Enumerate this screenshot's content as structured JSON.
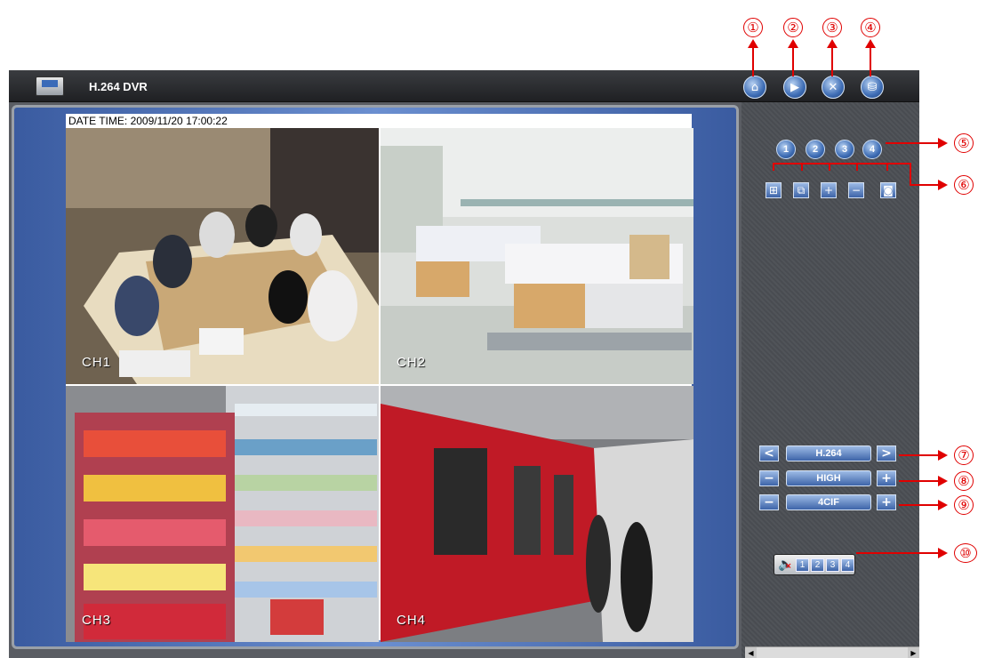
{
  "app": {
    "title": "H.264 DVR"
  },
  "viewer": {
    "datetime": "DATE TIME: 2009/11/20 17:00:22",
    "channels": [
      {
        "label": "CH1"
      },
      {
        "label": "CH2"
      },
      {
        "label": "CH3"
      },
      {
        "label": "CH4"
      }
    ]
  },
  "toolbar": {
    "buttons": [
      {
        "icon": "home-icon",
        "glyph": "⌂"
      },
      {
        "icon": "playback-icon",
        "glyph": "▶"
      },
      {
        "icon": "tools-icon",
        "glyph": "✕"
      },
      {
        "icon": "network-icon",
        "glyph": "⛁"
      }
    ]
  },
  "panel": {
    "channel_buttons": [
      "1",
      "2",
      "3",
      "4"
    ],
    "layout_buttons": [
      {
        "icon": "quad-layout-icon",
        "glyph": "⊞"
      },
      {
        "icon": "sequence-icon",
        "glyph": "⧉"
      },
      {
        "icon": "zoom-in-icon",
        "glyph": "+"
      },
      {
        "icon": "zoom-out-icon",
        "glyph": "−"
      },
      {
        "icon": "snapshot-icon",
        "glyph": "◙"
      }
    ],
    "codec": {
      "prev": "<",
      "value": "H.264",
      "next": ">"
    },
    "quality": {
      "minus": "−",
      "value": "HIGH",
      "plus": "+"
    },
    "resolution": {
      "minus": "−",
      "value": "4CIF",
      "plus": "+"
    },
    "audio": {
      "channels": [
        "1",
        "2",
        "3",
        "4"
      ]
    }
  },
  "callouts": [
    "①",
    "②",
    "③",
    "④",
    "⑤",
    "⑥",
    "⑦",
    "⑧",
    "⑨",
    "⑩"
  ],
  "colors": {
    "accent": "#3e6db5",
    "callout": "#e00000",
    "titlebar": "#1f2023"
  }
}
